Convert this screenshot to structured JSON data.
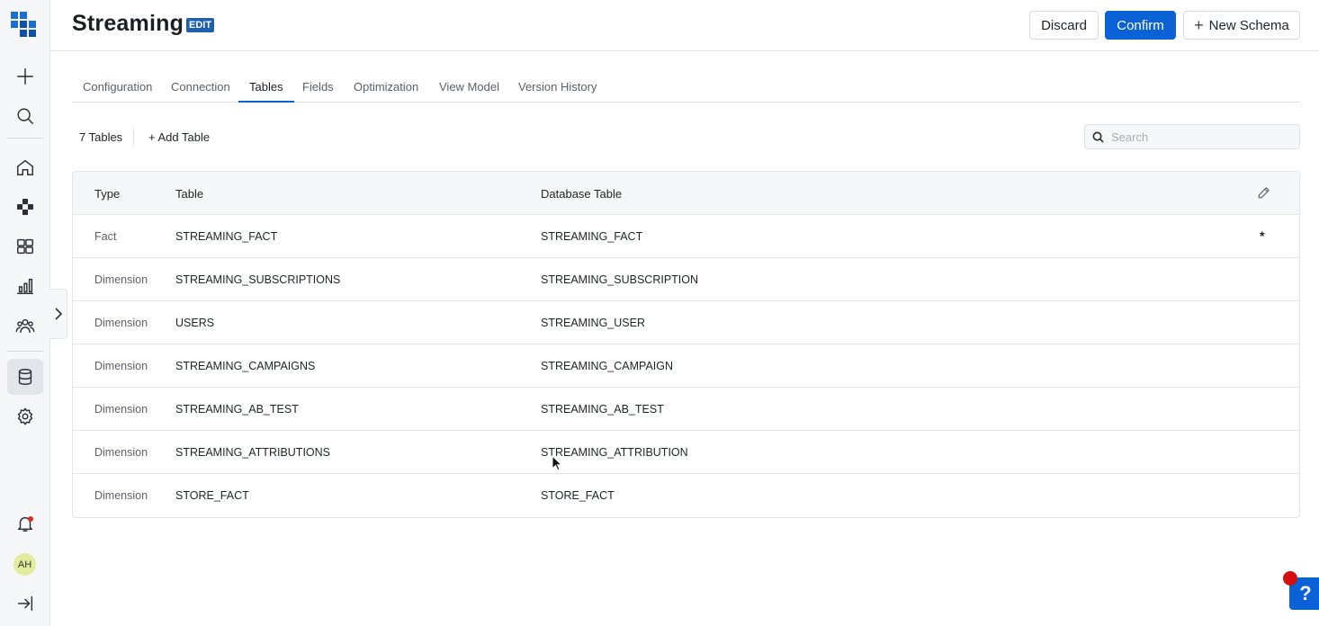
{
  "app": {
    "title": "Streaming",
    "badge": "EDIT",
    "accent_color": "#0a62d6"
  },
  "header": {
    "discard_label": "Discard",
    "confirm_label": "Confirm",
    "new_schema_label": "New Schema"
  },
  "rail": {
    "icons": [
      "logo-icon",
      "plus-icon",
      "search-icon",
      "home-icon",
      "nodes-icon",
      "dashboard-icon",
      "bar-chart-icon",
      "users-icon",
      "database-icon",
      "settings-icon",
      "bell-icon",
      "collapse-icon"
    ],
    "avatar_initials": "AH",
    "active_item": "database-icon"
  },
  "tabs": [
    {
      "label": "Configuration"
    },
    {
      "label": "Connection"
    },
    {
      "label": "Tables",
      "active": true
    },
    {
      "label": "Fields"
    },
    {
      "label": "Optimization"
    },
    {
      "label": "View Model"
    },
    {
      "label": "Version History"
    }
  ],
  "toolbar": {
    "count_label": "7 Tables",
    "add_table_label": "+ Add Table",
    "search_placeholder": "Search"
  },
  "table": {
    "columns": [
      "Type",
      "Table",
      "Database Table"
    ],
    "rows": [
      {
        "type": "Fact",
        "table": "STREAMING_FACT",
        "database_table": "STREAMING_FACT",
        "mark": "*"
      },
      {
        "type": "Dimension",
        "table": "STREAMING_SUBSCRIPTIONS",
        "database_table": "STREAMING_SUBSCRIPTION",
        "mark": ""
      },
      {
        "type": "Dimension",
        "table": "USERS",
        "database_table": "STREAMING_USER",
        "mark": ""
      },
      {
        "type": "Dimension",
        "table": "STREAMING_CAMPAIGNS",
        "database_table": "STREAMING_CAMPAIGN",
        "mark": ""
      },
      {
        "type": "Dimension",
        "table": "STREAMING_AB_TEST",
        "database_table": "STREAMING_AB_TEST",
        "mark": ""
      },
      {
        "type": "Dimension",
        "table": "STREAMING_ATTRIBUTIONS",
        "database_table": "STREAMING_ATTRIBUTION",
        "mark": ""
      },
      {
        "type": "Dimension",
        "table": "STORE_FACT",
        "database_table": "STORE_FACT",
        "mark": ""
      }
    ]
  },
  "help": {
    "label": "?"
  }
}
